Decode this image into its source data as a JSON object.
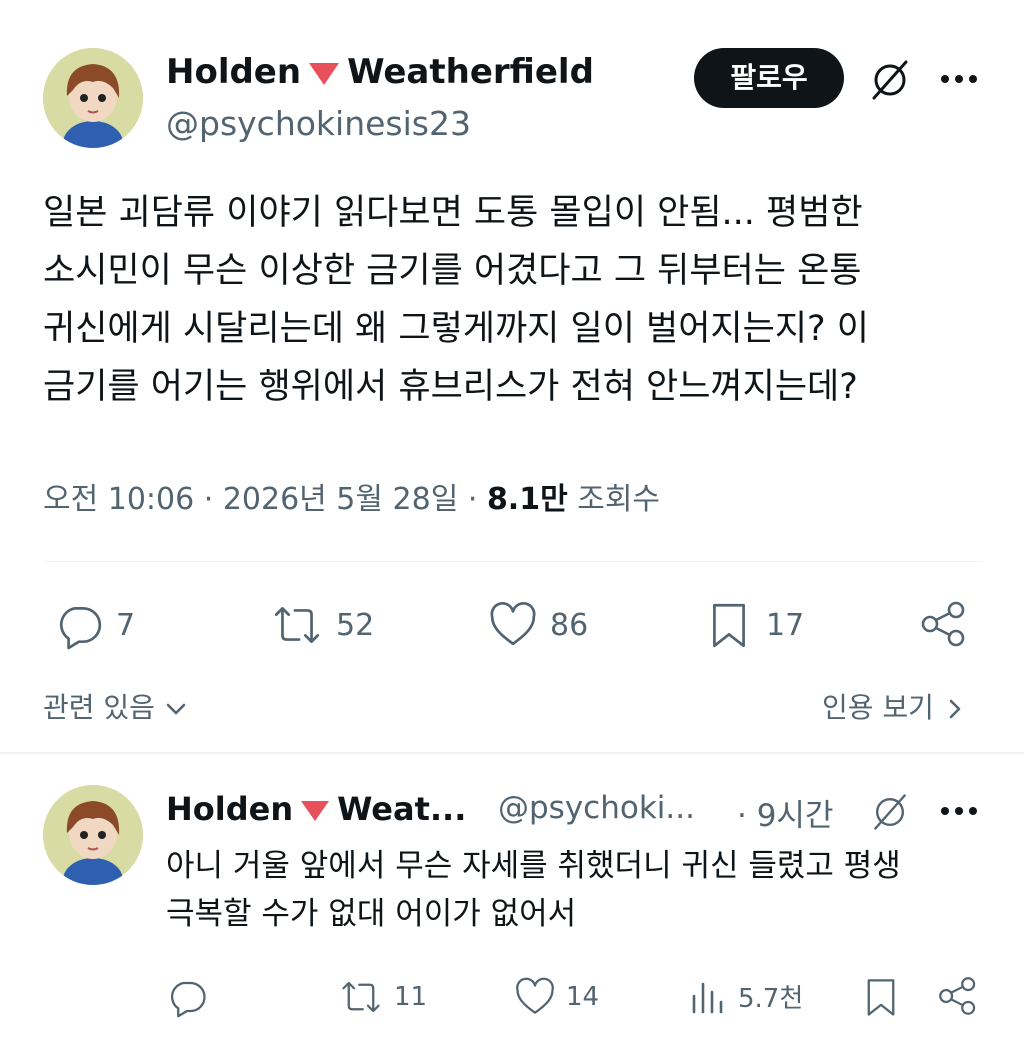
{
  "tweet": {
    "display_name_first": "Holden",
    "display_name_last": "Weatherfield",
    "handle": "@psychokinesis23",
    "follow_label": "팔로우",
    "text_lines": [
      "일본 괴담류 이야기 읽다보면 도통 몰입이 안됨... 평범한",
      "소시민이 무슨 이상한 금기를 어겼다고 그 뒤부터는 온통",
      "귀신에게 시달리는데 왜 그렇게까지 일이 벌어지는지? 이",
      "금기를 어기는 행위에서 휴브리스가 전혀 안느껴지는데?"
    ],
    "time": "오전 10:06",
    "date": "2026년 5월 28일",
    "views_count": "8.1만",
    "views_label": "조회수",
    "replies": "7",
    "retweets": "52",
    "likes": "86",
    "bookmarks": "17",
    "related_label": "관련 있음",
    "quotes_label": "인용 보기"
  },
  "reply": {
    "display_name_first": "Holden",
    "display_name_last": "Weat...",
    "handle": "@psychoki...",
    "time_ago": "· 9시간",
    "text_lines": [
      "아니 거울 앞에서 무슨 자세를 취했더니 귀신 들렸고 평생",
      "극복할 수가 없대 어이가 없어서"
    ],
    "replies": "",
    "retweets": "11",
    "likes": "14",
    "views": "5.7천"
  },
  "icons": {
    "avatar": "avatar-image",
    "grok": "grok-icon",
    "more": "more-icon",
    "reply": "reply-icon",
    "retweet": "retweet-icon",
    "like": "heart-icon",
    "bookmark": "bookmark-icon",
    "share": "share-icon",
    "views": "views-icon"
  },
  "colors": {
    "accent_triangle": "#e8505b",
    "follow_bg": "#0f1419",
    "secondary_text": "#536471"
  }
}
